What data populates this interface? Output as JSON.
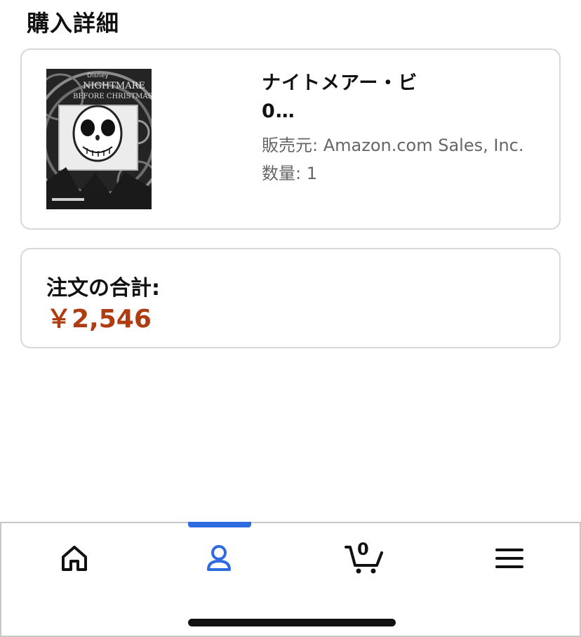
{
  "page": {
    "title": "購入詳細"
  },
  "item": {
    "name": "ナイトメアー・ビ0…",
    "seller": "販売元: Amazon.com Sales, Inc.",
    "quantity": "数量: 1",
    "thumbnail_icon": "dvd-cover-image"
  },
  "order": {
    "total_label": "注文の合計:",
    "total_value": "￥2,546"
  },
  "nav": {
    "items": [
      {
        "name": "home",
        "icon": "home-icon"
      },
      {
        "name": "account",
        "icon": "user-icon",
        "active": true
      },
      {
        "name": "cart",
        "icon": "cart-icon",
        "count": "0"
      },
      {
        "name": "menu",
        "icon": "hamburger-icon"
      }
    ]
  },
  "colors": {
    "accent": "#2f6be0",
    "price": "#b03c12",
    "border": "#d8d8d8"
  }
}
